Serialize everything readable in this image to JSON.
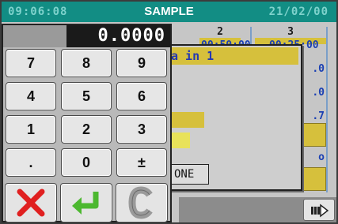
{
  "header": {
    "time": "09:06:08",
    "title": "SAMPLE",
    "date": "21/02/00"
  },
  "background_table": {
    "columns": [
      {
        "number": "2",
        "time_partial": "00:50:00"
      },
      {
        "number": "3",
        "time_partial": "00:25:00"
      }
    ],
    "cell_values": [
      ".0",
      ".0",
      ".7",
      "o"
    ]
  },
  "popup": {
    "title": "a in 1",
    "button_label": "ONE"
  },
  "keypad": {
    "display_value": "0.0000",
    "keys": [
      [
        "7",
        "8",
        "9"
      ],
      [
        "4",
        "5",
        "6"
      ],
      [
        "1",
        "2",
        "3"
      ],
      [
        ".",
        "0",
        "±"
      ]
    ],
    "actions": {
      "cancel_icon": "cancel-x-icon",
      "enter_icon": "enter-arrow-icon",
      "clear_icon": "clear-c-icon"
    },
    "colors": {
      "cancel": "#e02020",
      "enter": "#4cb830",
      "clear": "#9a9a9a"
    }
  },
  "footer": {
    "next_icon": "next-page-icon"
  }
}
